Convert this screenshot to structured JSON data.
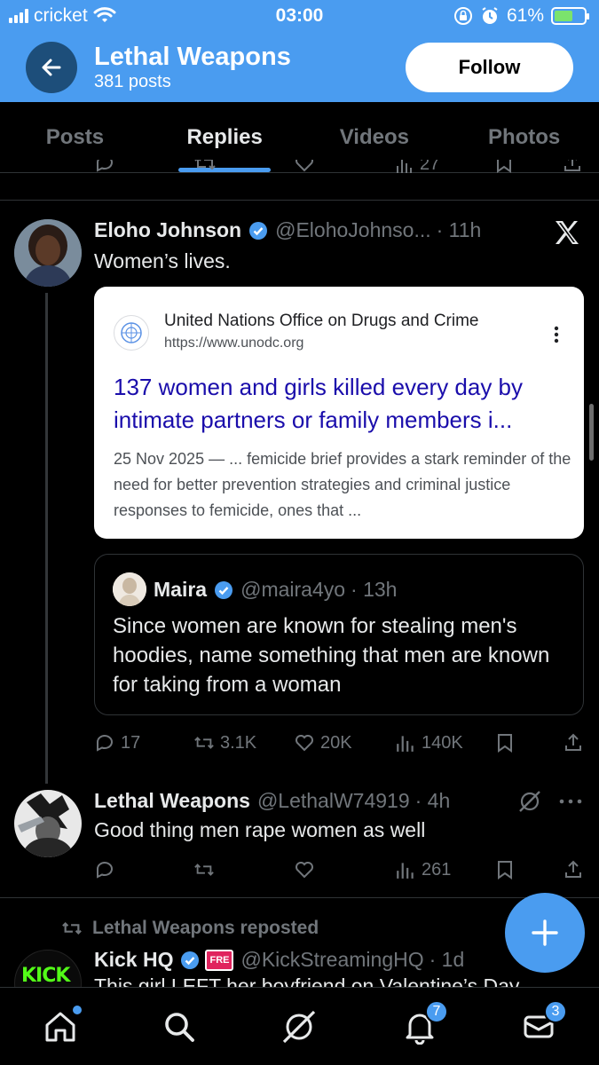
{
  "status_bar": {
    "carrier": "cricket",
    "time": "03:00",
    "battery": "61%"
  },
  "header": {
    "title": "Lethal Weapons",
    "posts_count": "381 posts",
    "follow_label": "Follow"
  },
  "tabs": [
    {
      "label": "Posts"
    },
    {
      "label": "Replies",
      "active": true
    },
    {
      "label": "Videos"
    },
    {
      "label": "Photos"
    }
  ],
  "partial_row": {
    "views": "27"
  },
  "tweet1": {
    "name": "Eloho Johnson",
    "handle": "@ElohoJohnso...",
    "time": "· 11h",
    "text": "Women’s lives.",
    "link_card": {
      "source": "United Nations Office on Drugs and Crime",
      "url": "https://www.unodc.org",
      "title": "137 women and girls killed every day by intimate partners or family members i...",
      "snippet": "25 Nov 2025 — ... femicide brief provides a stark reminder of the need for better prevention strategies and criminal justice responses to femicide, ones that ..."
    },
    "quote": {
      "name": "Maira",
      "handle": "@maira4yo",
      "time": "· 13h",
      "text": "Since women are known for stealing men's hoodies, name something that men are known for taking from a woman"
    },
    "stats": {
      "replies": "17",
      "reposts": "3.1K",
      "likes": "20K",
      "views": "140K"
    }
  },
  "tweet2": {
    "name": "Lethal Weapons",
    "handle": "@LethalW74919",
    "time": "· 4h",
    "text": "Good thing men rape women as well",
    "stats": {
      "views": "261"
    }
  },
  "tweet3": {
    "repost_label": "Lethal Weapons reposted",
    "name": "Kick HQ",
    "handle": "@KickStreamingHQ",
    "time": "· 1d",
    "text": "This girl LEFT her boyfriend on Valentine’s Day",
    "avatar_text": "KICK",
    "badge_text": "FRE"
  },
  "bottom_nav": {
    "notifications_badge": "7",
    "messages_badge": "3"
  },
  "colors": {
    "accent": "#4a9cf0",
    "background": "#000000",
    "muted": "#71767b",
    "link": "#1a0dab"
  }
}
